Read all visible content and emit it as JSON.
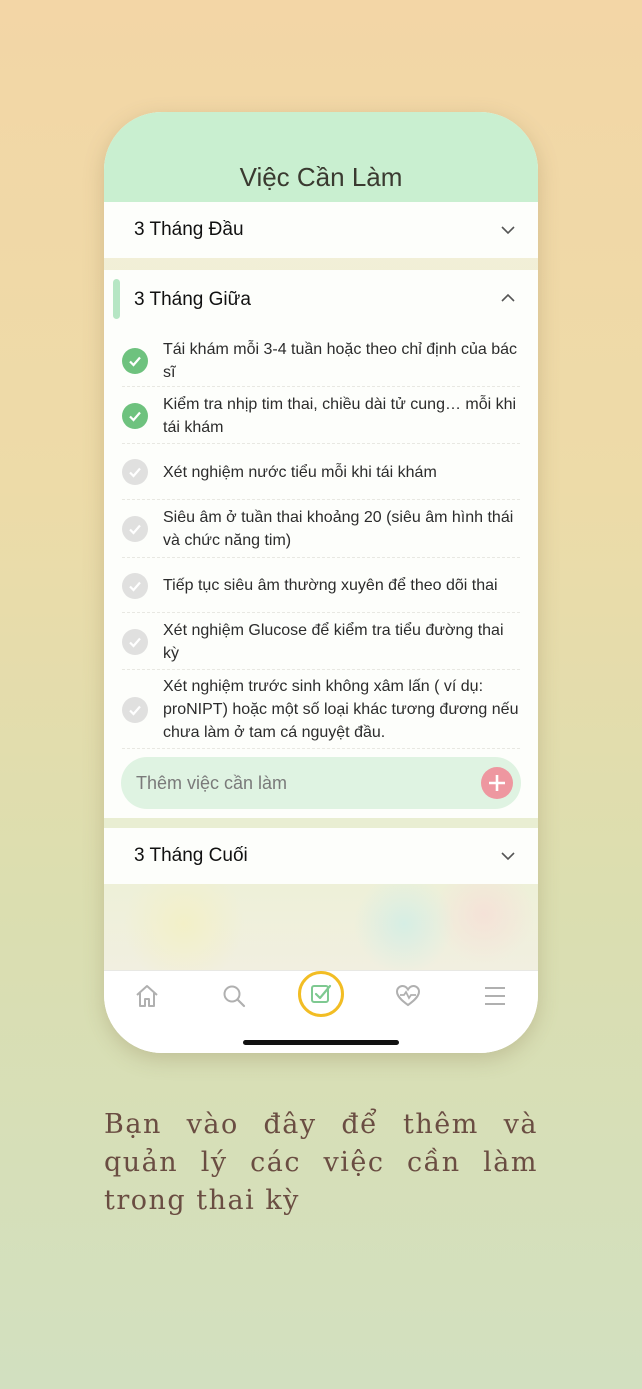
{
  "header": {
    "title": "Việc Cần Làm"
  },
  "sections": [
    {
      "title": "3 Tháng Đầu",
      "state": "collapsed"
    },
    {
      "title": "3 Tháng Giữa",
      "state": "expanded",
      "tasks": [
        {
          "text": "Tái khám mỗi 3-4 tuần hoặc theo chỉ định của bác sĩ",
          "done": true
        },
        {
          "text": "Kiểm tra nhịp tim thai, chiều dài tử cung… mỗi khi tái khám",
          "done": true
        },
        {
          "text": "Xét nghiệm nước tiểu mỗi khi tái khám",
          "done": false
        },
        {
          "text": "Siêu âm ở tuần thai khoảng 20 (siêu âm hình thái và chức năng tim)",
          "done": false
        },
        {
          "text": "Tiếp tục siêu âm thường xuyên để theo dõi thai",
          "done": false
        },
        {
          "text": "Xét nghiệm Glucose để kiểm tra tiểu đường thai kỳ",
          "done": false
        },
        {
          "text": "Xét nghiệm trước sinh không xâm lấn ( ví dụ: proNIPT) hoặc một số loại khác tương đương nếu chưa làm ở tam cá nguyệt đầu.",
          "done": false
        }
      ],
      "add_placeholder": "Thêm việc cần làm"
    },
    {
      "title": "3 Tháng Cuối",
      "state": "collapsed"
    }
  ],
  "tabbar": {
    "items": [
      {
        "icon": "home-icon"
      },
      {
        "icon": "search-icon"
      },
      {
        "icon": "checklist-icon",
        "active": true
      },
      {
        "icon": "heart-pulse-icon"
      },
      {
        "icon": "menu-icon"
      }
    ]
  },
  "caption": "Bạn vào đây để thêm và quản lý các việc cần làm trong thai kỳ",
  "colors": {
    "header_bg": "#c9efd0",
    "done_check": "#6ec27e",
    "todo_check": "#e0e0df",
    "add_button": "#ee97a0",
    "active_tab_ring": "#f2bd24"
  }
}
